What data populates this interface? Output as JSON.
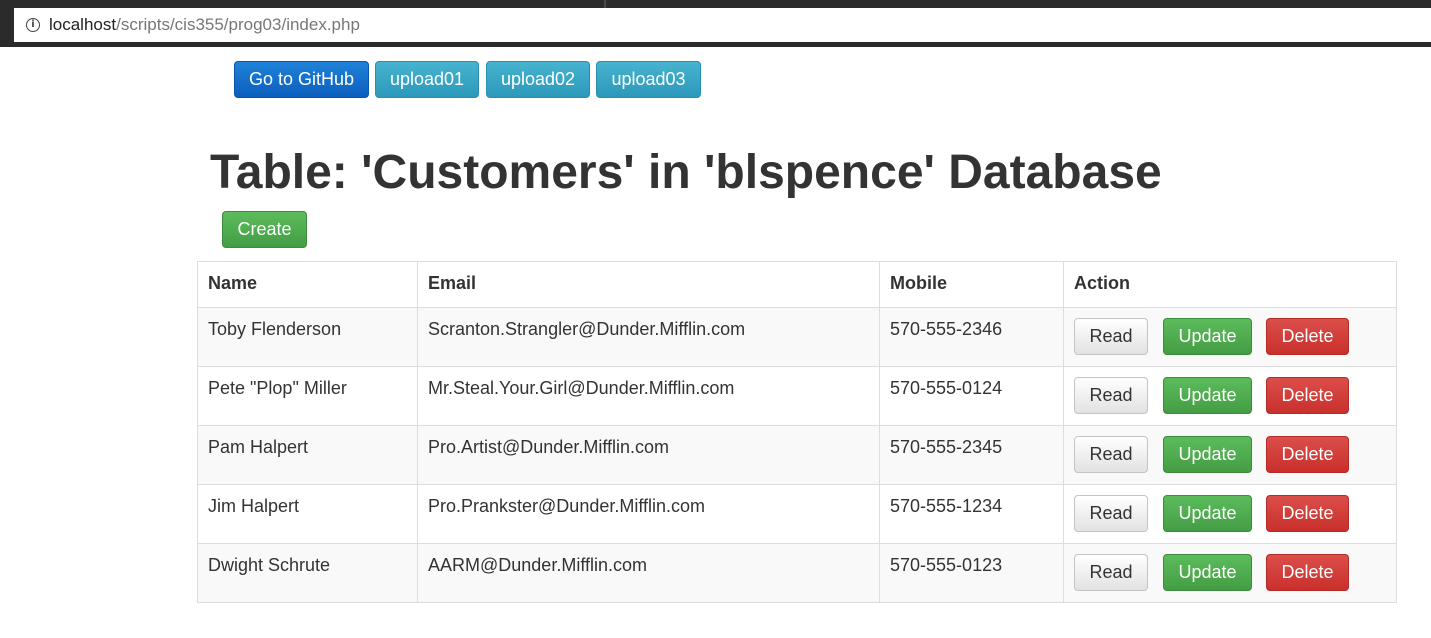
{
  "browser": {
    "url_host": "localhost",
    "url_path": "/scripts/cis355/prog03/index.php",
    "info_icon": "info-icon"
  },
  "nav": {
    "github": "Go to GitHub",
    "upload01": "upload01",
    "upload02": "upload02",
    "upload03": "upload03"
  },
  "page": {
    "title": "Table: 'Customers' in 'blspence' Database",
    "create_label": "Create"
  },
  "table": {
    "headers": [
      "Name",
      "Email",
      "Mobile",
      "Action"
    ],
    "rows": [
      {
        "name": "Toby Flenderson",
        "email": "Scranton.Strangler@Dunder.Mifflin.com",
        "mobile": "570-555-2346"
      },
      {
        "name": "Pete \"Plop\" Miller",
        "email": "Mr.Steal.Your.Girl@Dunder.Mifflin.com",
        "mobile": "570-555-0124"
      },
      {
        "name": "Pam Halpert",
        "email": "Pro.Artist@Dunder.Mifflin.com",
        "mobile": "570-555-2345"
      },
      {
        "name": "Jim Halpert",
        "email": "Pro.Prankster@Dunder.Mifflin.com",
        "mobile": "570-555-1234"
      },
      {
        "name": "Dwight Schrute",
        "email": "AARM@Dunder.Mifflin.com",
        "mobile": "570-555-0123"
      }
    ],
    "actions": {
      "read": "Read",
      "update": "Update",
      "delete": "Delete"
    }
  },
  "colors": {
    "primary": "#0b5fbd",
    "info": "#2c99bb",
    "success": "#449d44",
    "danger": "#c9302c"
  }
}
